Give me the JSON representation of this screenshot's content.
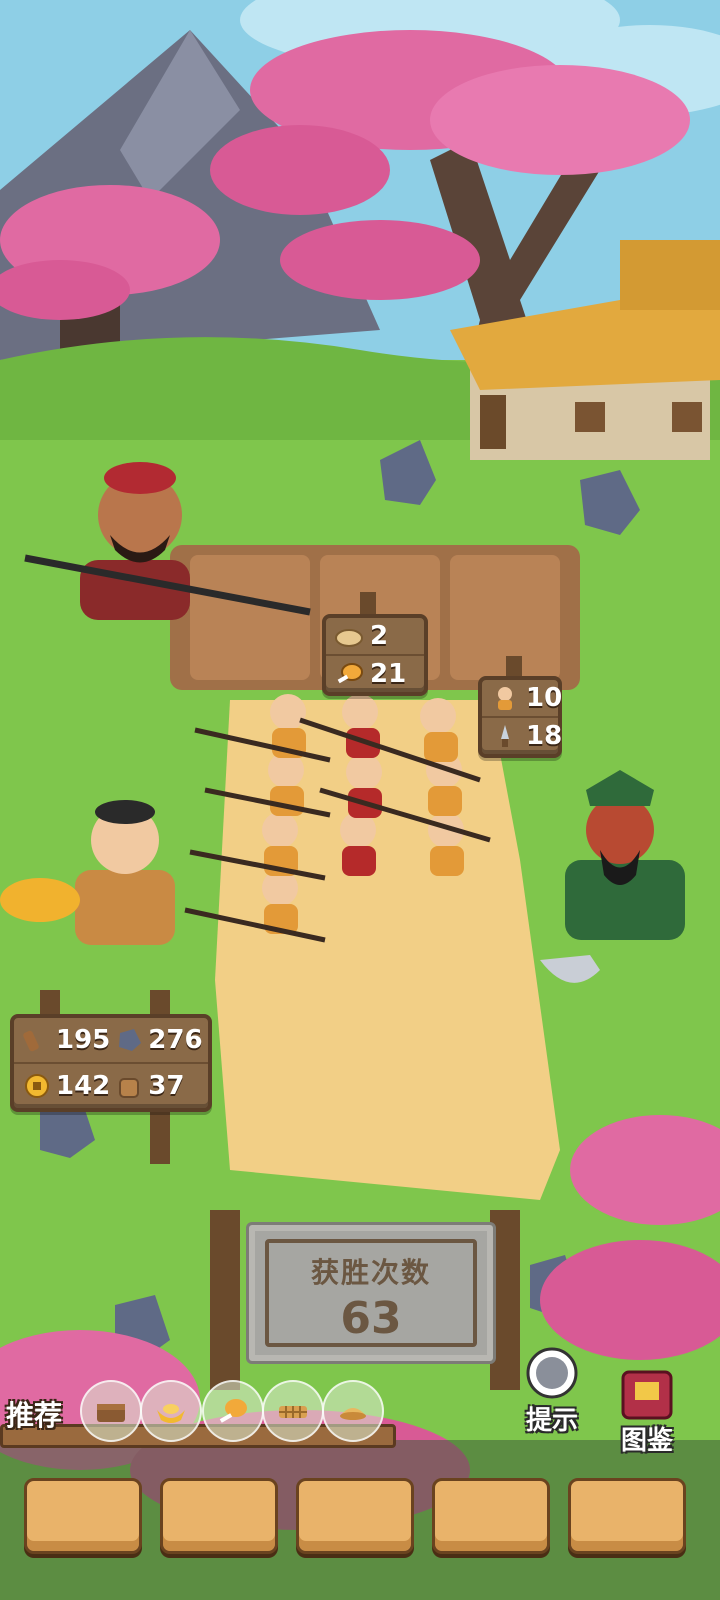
{
  "resources_top": {
    "bread": "2",
    "meat": "21"
  },
  "army_stats": {
    "soldiers": "10",
    "weapons": "18"
  },
  "materials": {
    "wood": "195",
    "stone": "276",
    "coins": "142",
    "baskets": "37"
  },
  "victory": {
    "label": "获胜次数",
    "count": "63"
  },
  "recommend": {
    "label": "推荐",
    "items": [
      "treasure-chest-icon",
      "gold-ingot-icon",
      "drumstick-icon",
      "woven-mat-icon",
      "pastry-icon"
    ]
  },
  "buttons": {
    "hint": "提示",
    "codex": "图鉴"
  },
  "colors": {
    "grass": "#7cc24a",
    "wood": "#8a6a48",
    "path": "#f2cf86",
    "blossom": "#e06aa2"
  }
}
